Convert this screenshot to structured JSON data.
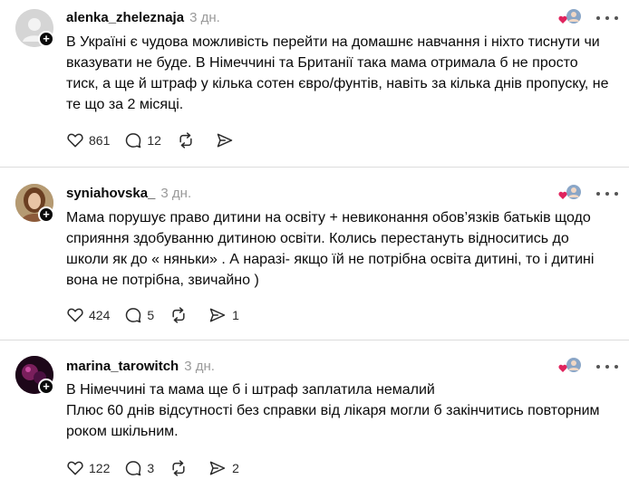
{
  "posts": [
    {
      "username": "alenka_zheleznaja",
      "time": "3 дн.",
      "text": "В Україні є чудова можливість перейти на домашнє навчання і ніхто тиснути чи вказувати не буде. В Німеччині та Британії така мама отримала б не просто тиск, а ще й штраф у кілька сотен євро/фунтів, навіть за кілька днів пропуску, не те що за 2 місяці.",
      "likes": "861",
      "replies": "12",
      "reposts": "",
      "shares": ""
    },
    {
      "username": "syniahovska_",
      "time": "3 дн.",
      "text": "Мама порушує право дитини на освіту + невиконання обов’язків батьків щодо сприяння здобуванню дитиною освіти. Колись перестануть відноситись до школи як до « няньки» . А наразі- якщо їй не потрібна освіта дитині, то і дитині вона не потрібна, звичайно )",
      "likes": "424",
      "replies": "5",
      "reposts": "",
      "shares": "1"
    },
    {
      "username": "marina_tarowitch",
      "time": "3 дн.",
      "text": "В Німеччині та мама ще б і штраф заплатила немалий\nПлюс 60 днів відсутності без справки від лікаря могли б закінчитись повторним роком шкільним.",
      "likes": "122",
      "replies": "3",
      "reposts": "",
      "shares": "2"
    }
  ],
  "colors": {
    "muted": "#9a9a9a",
    "divider": "#dcdcdc",
    "heart": "#e0245e"
  },
  "icons": [
    "heart-icon",
    "comment-icon",
    "repost-icon",
    "share-icon",
    "more-icon",
    "plus-icon"
  ]
}
